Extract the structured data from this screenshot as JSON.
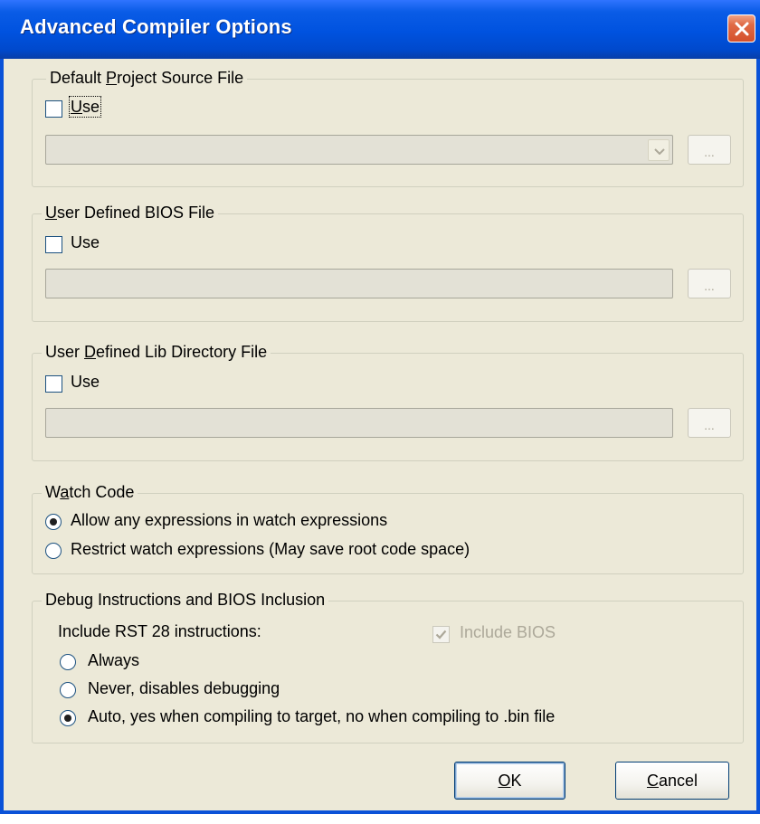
{
  "window": {
    "title": "Advanced Compiler Options"
  },
  "groups": {
    "default_source": {
      "legend_pre": "Default ",
      "legend_u": "P",
      "legend_post": "roject Source File",
      "use_u": "U",
      "use_post": "se",
      "checked": false,
      "value": "",
      "browse": "..."
    },
    "bios": {
      "legend_u": "U",
      "legend_post": "ser Defined BIOS File",
      "use": "Use",
      "checked": false,
      "value": "",
      "browse": "..."
    },
    "lib": {
      "legend_pre": "User ",
      "legend_u": "D",
      "legend_post": "efined Lib Directory File",
      "use": "Use",
      "checked": false,
      "value": "",
      "browse": "..."
    },
    "watch": {
      "legend_pre": "W",
      "legend_u": "a",
      "legend_post": "tch Code",
      "options": [
        "Allow any expressions in watch expressions",
        "Restrict watch expressions (May save root code space)"
      ],
      "selected": 0
    },
    "debug": {
      "legend_pre": "Debu",
      "legend_u": "g",
      "legend_post": " Instructions and BIOS Inclusion",
      "rst_label": "Include RST 28 instructions:",
      "include_bios": "Include BIOS",
      "include_bios_checked": true,
      "options": [
        "Always",
        "Never, disables debugging",
        "Auto, yes when compiling to target, no when compiling to .bin file"
      ],
      "selected": 2
    }
  },
  "buttons": {
    "ok_u": "O",
    "ok_post": "K",
    "cancel_u": "C",
    "cancel_post": "ancel"
  }
}
